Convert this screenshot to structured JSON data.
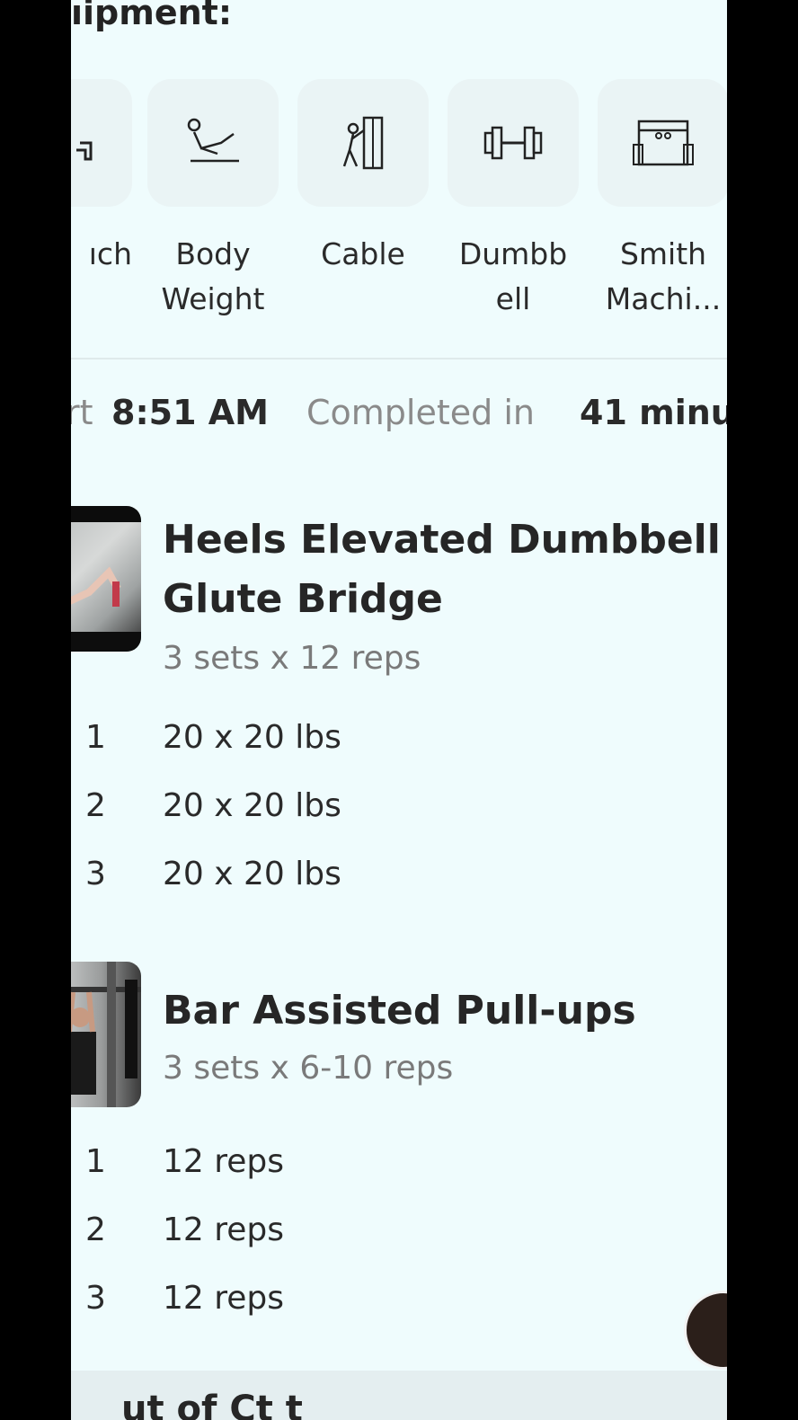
{
  "equipment": {
    "title": "ıipment:",
    "items": [
      {
        "label": "ıch",
        "icon": "bench-icon"
      },
      {
        "label": "Body\nWeight",
        "icon": "body-weight-icon"
      },
      {
        "label": "Cable",
        "icon": "cable-machine-icon"
      },
      {
        "label": "Dumbb\nell",
        "icon": "dumbbell-icon"
      },
      {
        "label": "Smith\nMachi...",
        "icon": "smith-machine-icon"
      }
    ]
  },
  "summary": {
    "start_label": "rt",
    "start_time": "8:51 AM",
    "completed_label": "Completed in",
    "duration": "41 minu"
  },
  "exercises": [
    {
      "title_line1": "Heels Elevated Dumbbell",
      "title_line2": "Glute Bridge",
      "scheme": "3 sets x 12 reps",
      "sets": [
        {
          "num": "1",
          "value": "20 x 20 lbs"
        },
        {
          "num": "2",
          "value": "20 x 20 lbs"
        },
        {
          "num": "3",
          "value": "20 x 20 lbs"
        }
      ]
    },
    {
      "title_line1": "Bar Assisted Pull-ups",
      "scheme": "3 sets x 6-10 reps",
      "sets": [
        {
          "num": "1",
          "value": "12 reps"
        },
        {
          "num": "2",
          "value": "12 reps"
        },
        {
          "num": "3",
          "value": "12 reps"
        }
      ]
    }
  ],
  "footer": {
    "partial_heading": "ut of Ct t"
  },
  "colors": {
    "background": "#effcfd",
    "tile": "#eaf4f5",
    "text": "#262626",
    "muted": "#7a7a7a"
  }
}
